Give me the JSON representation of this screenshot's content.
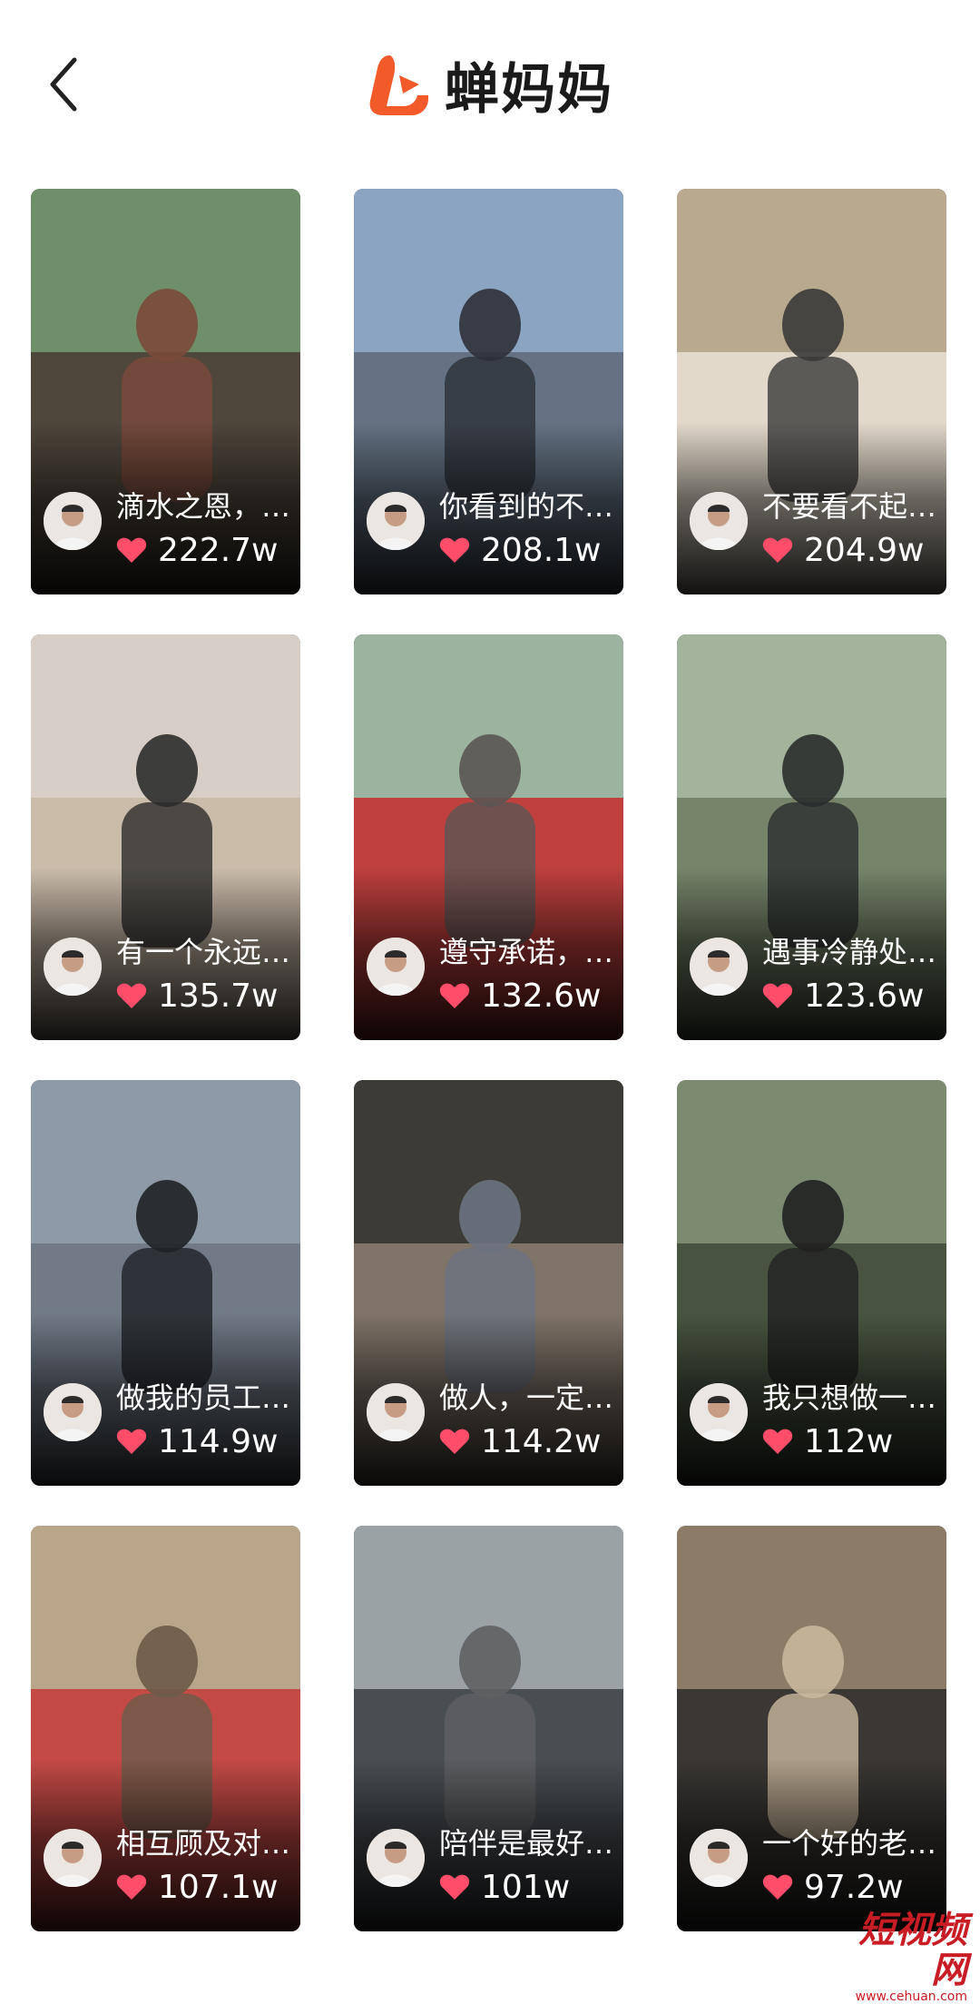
{
  "header": {
    "back_icon": "chevron-left-icon",
    "logo_icon": "chanmama-logo-icon",
    "brand_color": "#f25a2a",
    "app_name": "蝉妈妈"
  },
  "like_icon": "heart-icon",
  "like_color": "#ff4d6a",
  "videos": [
    {
      "title": "滴水之恩，…",
      "likes": "222.7w"
    },
    {
      "title": "你看到的不…",
      "likes": "208.1w"
    },
    {
      "title": "不要看不起…",
      "likes": "204.9w"
    },
    {
      "title": "有一个永远…",
      "likes": "135.7w"
    },
    {
      "title": "遵守承诺，…",
      "likes": "132.6w"
    },
    {
      "title": "遇事冷静处…",
      "likes": "123.6w"
    },
    {
      "title": "做我的员工…",
      "likes": "114.9w"
    },
    {
      "title": "做人，一定…",
      "likes": "114.2w"
    },
    {
      "title": "我只想做一…",
      "likes": "112w"
    },
    {
      "title": "相互顾及对…",
      "likes": "107.1w"
    },
    {
      "title": "陪伴是最好…",
      "likes": "101w"
    },
    {
      "title": "一个好的老…",
      "likes": "97.2w"
    }
  ],
  "watermark": {
    "main": "短视频网",
    "sub": "www.cehuan.com"
  }
}
